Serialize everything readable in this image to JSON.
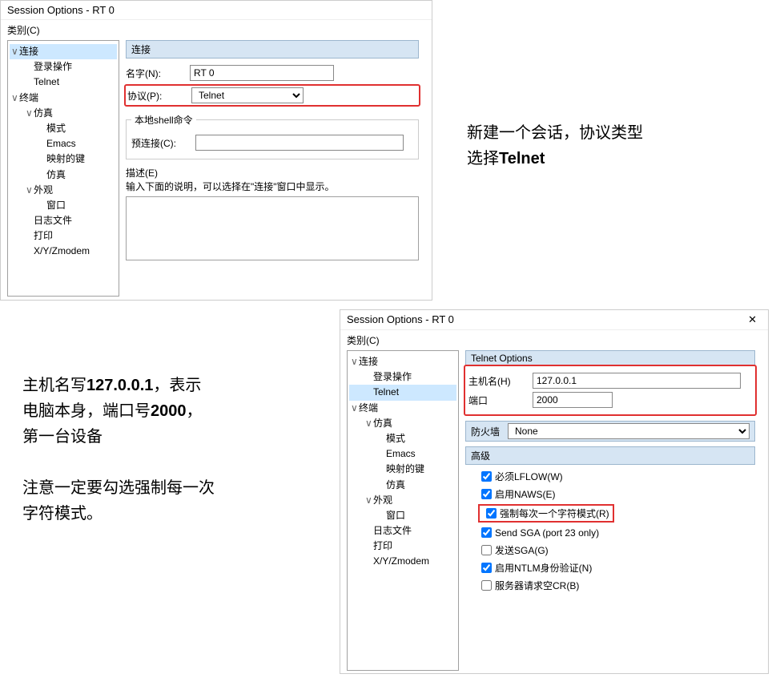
{
  "win1": {
    "title": "Session Options - RT 0",
    "category_label": "类别(C)",
    "tree": [
      {
        "label": "连接",
        "level": 0,
        "caret": "∨",
        "sel": true
      },
      {
        "label": "登录操作",
        "level": 1
      },
      {
        "label": "Telnet",
        "level": 1
      },
      {
        "label": "终端",
        "level": 0,
        "caret": "∨"
      },
      {
        "label": "仿真",
        "level": 1,
        "caret": "∨"
      },
      {
        "label": "模式",
        "level": 2
      },
      {
        "label": "Emacs",
        "level": 2
      },
      {
        "label": "映射的键",
        "level": 2
      },
      {
        "label": "仿真",
        "level": 2
      },
      {
        "label": "外观",
        "level": 1,
        "caret": "∨"
      },
      {
        "label": "窗口",
        "level": 2
      },
      {
        "label": "日志文件",
        "level": 1
      },
      {
        "label": "打印",
        "level": 1
      },
      {
        "label": "X/Y/Zmodem",
        "level": 1
      }
    ],
    "section_title": "连接",
    "name_label": "名字(N):",
    "name_value": "RT 0",
    "protocol_label": "协议(P):",
    "protocol_value": "Telnet",
    "shell_legend": "本地shell命令",
    "preconnect_label": "预连接(C):",
    "desc_legend": "描述(E)",
    "desc_hint": "输入下面的说明，可以选择在\"连接\"窗口中显示。"
  },
  "annot1_line1": "新建一个会话，协议类型",
  "annot1_line2": "选择Telnet",
  "annot2_line1": "主机名写127.0.0.1，表示",
  "annot2_line2": "电脑本身，端口号2000，",
  "annot2_line3": "第一台设备",
  "annot2_line4": "注意一定要勾选强制每一次",
  "annot2_line5": "字符模式。",
  "win2": {
    "title": "Session Options - RT 0",
    "category_label": "类别(C)",
    "tree": [
      {
        "label": "连接",
        "level": 0,
        "caret": "∨"
      },
      {
        "label": "登录操作",
        "level": 1
      },
      {
        "label": "Telnet",
        "level": 1,
        "sel": true
      },
      {
        "label": "终端",
        "level": 0,
        "caret": "∨"
      },
      {
        "label": "仿真",
        "level": 1,
        "caret": "∨"
      },
      {
        "label": "模式",
        "level": 2
      },
      {
        "label": "Emacs",
        "level": 2
      },
      {
        "label": "映射的键",
        "level": 2
      },
      {
        "label": "仿真",
        "level": 2
      },
      {
        "label": "外观",
        "level": 1,
        "caret": "∨"
      },
      {
        "label": "窗口",
        "level": 2
      },
      {
        "label": "日志文件",
        "level": 1
      },
      {
        "label": "打印",
        "level": 1
      },
      {
        "label": "X/Y/Zmodem",
        "level": 1
      }
    ],
    "section_title": "Telnet Options",
    "host_label": "主机名(H)",
    "host_value": "127.0.0.1",
    "port_label": "端口",
    "port_value": "2000",
    "firewall_label": "防火墙",
    "firewall_value": "None",
    "advanced_label": "高级",
    "chk_lflow": "必须LFLOW(W)",
    "chk_naws": "启用NAWS(E)",
    "chk_force": "强制每次一个字符模式(R)",
    "chk_sendsga": "Send SGA (port 23 only)",
    "chk_fasga": "发送SGA(G)",
    "chk_ntlm": "启用NTLM身份验证(N)",
    "chk_cr": "服务器请求空CR(B)"
  }
}
